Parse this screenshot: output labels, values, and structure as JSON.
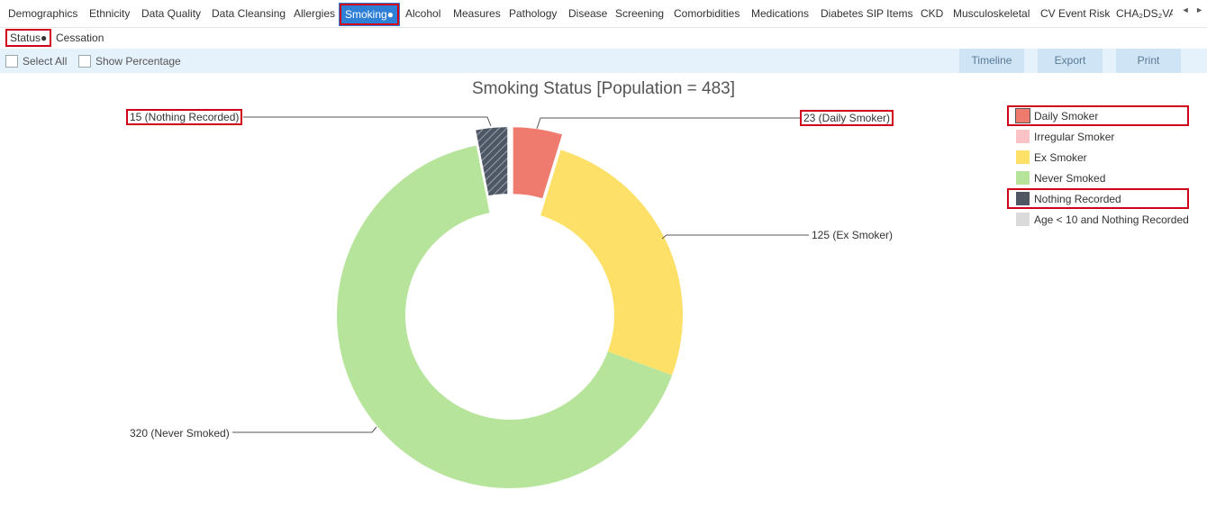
{
  "nav": {
    "tabs": [
      "Demographics",
      "Ethnicity",
      "Data Quality",
      "Data Cleansing",
      "Allergies",
      "Smoking●",
      "Alcohol",
      "Measures",
      "Pathology",
      "Disease",
      "Screening",
      "Comorbidities",
      "Medications",
      "Diabetes SIP Items",
      "CKD",
      "Musculoskeletal",
      "CV Event Risk",
      "CHA₂DS₂VA"
    ],
    "active_tab": "Smoking●",
    "prev_arrow": "◄",
    "next_arrow": "►"
  },
  "subnav": {
    "tabs": [
      "Status●",
      "Cessation"
    ],
    "active": "Status●"
  },
  "toolbar": {
    "select_all": "Select All",
    "show_percentage": "Show Percentage",
    "timeline": "Timeline",
    "export": "Export",
    "print": "Print"
  },
  "colors": {
    "accent": "#2e7fd6",
    "highlight_border": "#d0021b",
    "toolbar_bg": "#e6f2fb",
    "button_bg": "#cfe4f5"
  },
  "chart_data": {
    "type": "pie",
    "title": "Smoking Status [Population = 483]",
    "donut": true,
    "categories": [
      "Daily Smoker",
      "Irregular Smoker",
      "Ex Smoker",
      "Never Smoked",
      "Nothing Recorded",
      "Age < 10 and Nothing Recorded"
    ],
    "values": [
      23,
      0,
      125,
      320,
      15,
      0
    ],
    "colors": [
      "#ef7b6e",
      "#fcc3c7",
      "#fde067",
      "#b7e49b",
      "#4f5765",
      "#dadada"
    ],
    "exploded": [
      "Daily Smoker",
      "Nothing Recorded"
    ],
    "hatched": [
      "Nothing Recorded"
    ],
    "labels": [
      "23 (Daily Smoker)",
      "",
      "125 (Ex Smoker)",
      "320 (Never Smoked)",
      "15 (Nothing Recorded)",
      ""
    ],
    "legend_position": "right"
  }
}
